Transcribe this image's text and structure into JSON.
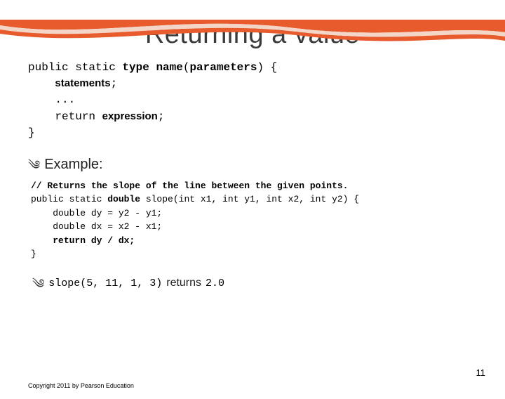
{
  "title": "Returning a value",
  "syntax": {
    "prefix": "public static ",
    "type": "type",
    "name": "name",
    "parameters": "parameters",
    "statements_label": "statements",
    "ellipsis": "...",
    "return_kw": "return ",
    "expression_label": "expression"
  },
  "example_heading": "Example:",
  "example": {
    "comment": "// Returns the slope of the line between the given points.",
    "line1a": "public static ",
    "line1b": "double",
    "line1c": " slope(int x1, int y1, int x2, int y2) {",
    "line2": "    double dy = y2 - y1;",
    "line3": "    double dx = x2 - x1;",
    "line4a": "    ",
    "line4b": "return dy / dx;",
    "line5": "}"
  },
  "result": {
    "call": "slope(5, 11, 1, 3)",
    "label": " returns ",
    "value": "2.0"
  },
  "footer": "Copyright 2011 by Pearson Education",
  "page_number": "11"
}
